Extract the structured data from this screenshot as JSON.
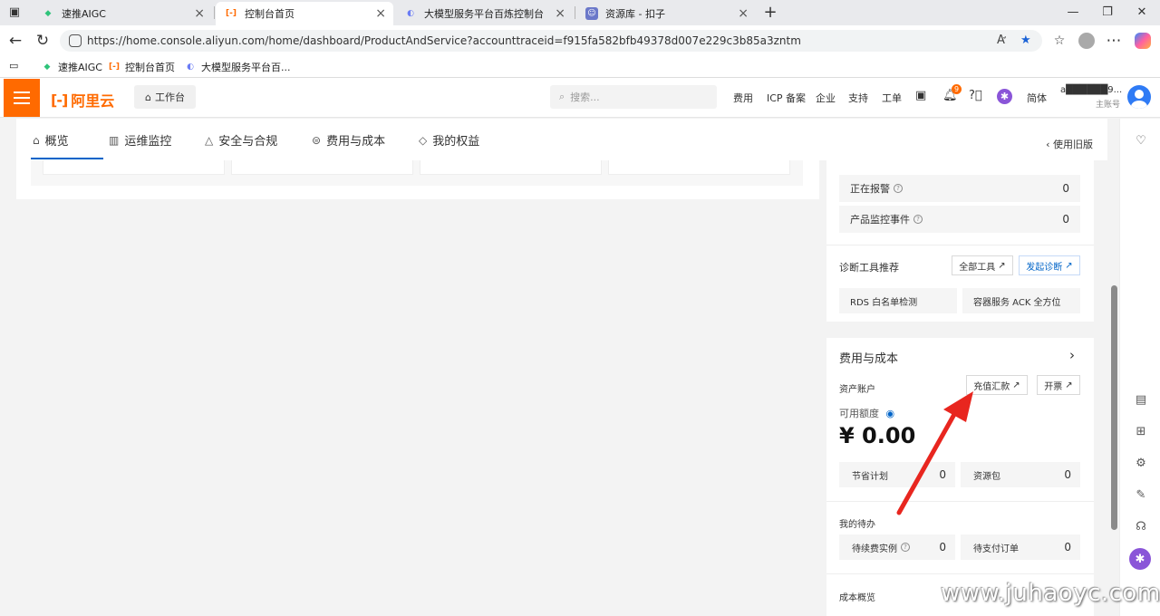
{
  "browser": {
    "tabs": [
      {
        "title": "速推AIGC",
        "active": false
      },
      {
        "title": "控制台首页",
        "active": true
      },
      {
        "title": "大模型服务平台百炼控制台",
        "active": false
      },
      {
        "title": "资源库 - 扣子",
        "active": false
      }
    ],
    "url": "https://home.console.aliyun.com/home/dashboard/ProductAndService?accounttraceid=f915fa582bfb49378d007e229c3b85a3zntm",
    "bookmarks": [
      "速推AIGC",
      "控制台首页",
      "大模型服务平台百..."
    ]
  },
  "console": {
    "logo_text": "阿里云",
    "workbench_label": "工作台",
    "search_placeholder": "搜索...",
    "nav": {
      "cost": "费用",
      "icp": "ICP 备案",
      "enterprise": "企业",
      "support": "支持",
      "ticket": "工单",
      "lang": "简体"
    },
    "notification_count": "9",
    "account": {
      "name": "a██████9...",
      "sub": "主账号"
    },
    "subnav": {
      "tabs": [
        "概览",
        "运维监控",
        "安全与合规",
        "费用与成本",
        "我的权益"
      ],
      "old_version": "使用旧版"
    },
    "monitor": {
      "alarming_label": "正在报警",
      "alarming_value": "0",
      "events_label": "产品监控事件",
      "events_value": "0"
    },
    "diagnostics": {
      "title": "诊断工具推荐",
      "all_tools": "全部工具",
      "start_diag": "发起诊断",
      "tool1": "RDS 白名单检测",
      "tool2": "容器服务 ACK 全方位"
    },
    "billing": {
      "title": "费用与成本",
      "assets_label": "资产账户",
      "recharge": "充值汇款",
      "invoice": "开票",
      "available_label": "可用额度",
      "amount": "¥ 0.00",
      "savings_plan_label": "节省计划",
      "savings_plan_value": "0",
      "resource_pack_label": "资源包",
      "resource_pack_value": "0",
      "todo_title": "我的待办",
      "renew_label": "待续费实例",
      "renew_value": "0",
      "unpaid_label": "待支付订单",
      "unpaid_value": "0",
      "cost_overview": "成本概览"
    }
  },
  "watermark": "www.juhaoyc.com",
  "colors": {
    "brand": "#ff6a00",
    "link": "#0064c8",
    "annotation_arrow": "#e8261f"
  }
}
